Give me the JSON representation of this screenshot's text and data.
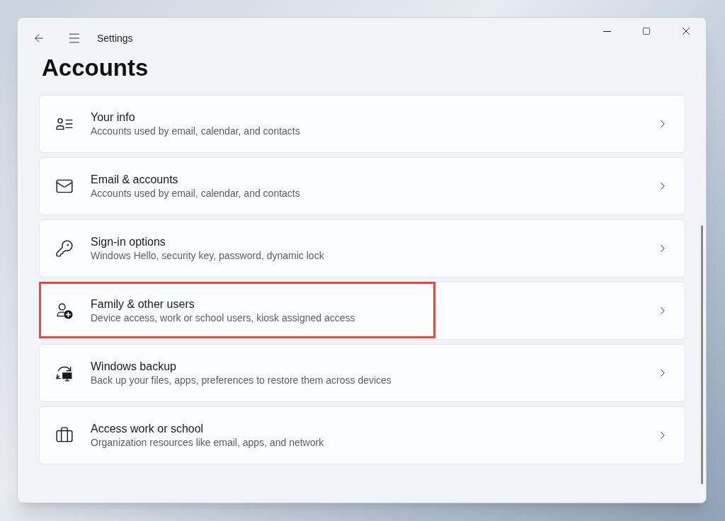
{
  "window": {
    "title": "Settings"
  },
  "page_title": "Accounts",
  "items": [
    {
      "kind": "info",
      "title": "Your info",
      "subtitle": "Accounts used by email, calendar, and contacts",
      "highlighted": false
    },
    {
      "kind": "email",
      "title": "Email & accounts",
      "subtitle": "Accounts used by email, calendar, and contacts",
      "highlighted": false
    },
    {
      "kind": "signin",
      "title": "Sign-in options",
      "subtitle": "Windows Hello, security key, password, dynamic lock",
      "highlighted": false
    },
    {
      "kind": "family",
      "title": "Family & other users",
      "subtitle": "Device access, work or school users, kiosk assigned access",
      "highlighted": true
    },
    {
      "kind": "backup",
      "title": "Windows backup",
      "subtitle": "Back up your files, apps, preferences to restore them across devices",
      "highlighted": false
    },
    {
      "kind": "work",
      "title": "Access work or school",
      "subtitle": "Organization resources like email, apps, and network",
      "highlighted": false
    }
  ]
}
